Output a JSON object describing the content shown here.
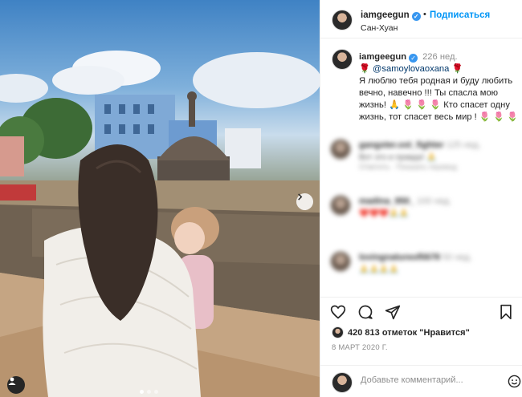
{
  "post": {
    "username": "iamgeegun",
    "follow_label": "Подписаться",
    "separator": "•",
    "location": "Сан-Хуан",
    "verified_mark": "✓"
  },
  "caption": {
    "username": "iamgeegun",
    "time": "226 нед.",
    "rose": "🌹",
    "mention": "@samoylovaoxana",
    "line1": "Я люблю тебя родная и буду любить вечно, навечно !!! Ты спасла мою жизнь!",
    "emoji_row1": "🙏 🌷 🌷 🌷",
    "line2": "Кто спасет одну жизнь, тот спасет весь мир !",
    "emoji_row2": "🌷 🌷 🌷"
  },
  "comments": [
    {
      "user": "gangster.ost_fighter",
      "time": "125 нед.",
      "text": "Вот это и правда! 🙏",
      "reply": "Ответить  ·  Показать перевод"
    },
    {
      "user": "madina_950_",
      "time": "100 нед.",
      "text": "❤️❤️❤️🙏🙏",
      "reply": ""
    },
    {
      "user": "lovingnatureofli678",
      "time": "50 нед.",
      "text": "🙏🙏🙏🙏",
      "reply": ""
    }
  ],
  "likes": {
    "text": "420 813 отметок \"Нравится\""
  },
  "date": "8 МАРТ 2020 Г.",
  "comment_input": {
    "placeholder": "Добавьте комментарий..."
  },
  "photo": {
    "carousel_dots": 3,
    "active_dot": 1
  },
  "icons": [
    "heart-icon",
    "comment-icon",
    "share-icon",
    "bookmark-icon",
    "emoji-icon",
    "chevron-right-icon",
    "user-tag-icon"
  ],
  "colors": {
    "follow_blue": "#0095f6",
    "verified_blue": "#3897f0",
    "muted": "#8e8e8e"
  }
}
